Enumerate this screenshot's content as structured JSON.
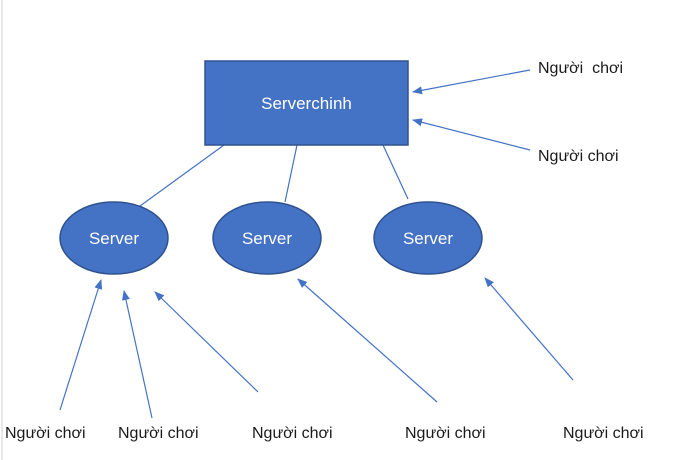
{
  "main_server": {
    "label": "Serverchinh",
    "fill": "#4472C4",
    "stroke": "#2F528F"
  },
  "sub_servers": [
    {
      "label": "Server"
    },
    {
      "label": "Server"
    },
    {
      "label": "Server"
    }
  ],
  "players_right": [
    {
      "label": "Người  chơi"
    },
    {
      "label": "Người chơi"
    }
  ],
  "players_bottom": [
    {
      "label": "Người chơi"
    },
    {
      "label": "Người chơi"
    },
    {
      "label": "Người chơi"
    },
    {
      "label": "Người chơi"
    },
    {
      "label": "Người chơi"
    }
  ],
  "colors": {
    "connector": "#4472C4",
    "shape_fill": "#4472C4",
    "shape_stroke": "#2F528F"
  }
}
